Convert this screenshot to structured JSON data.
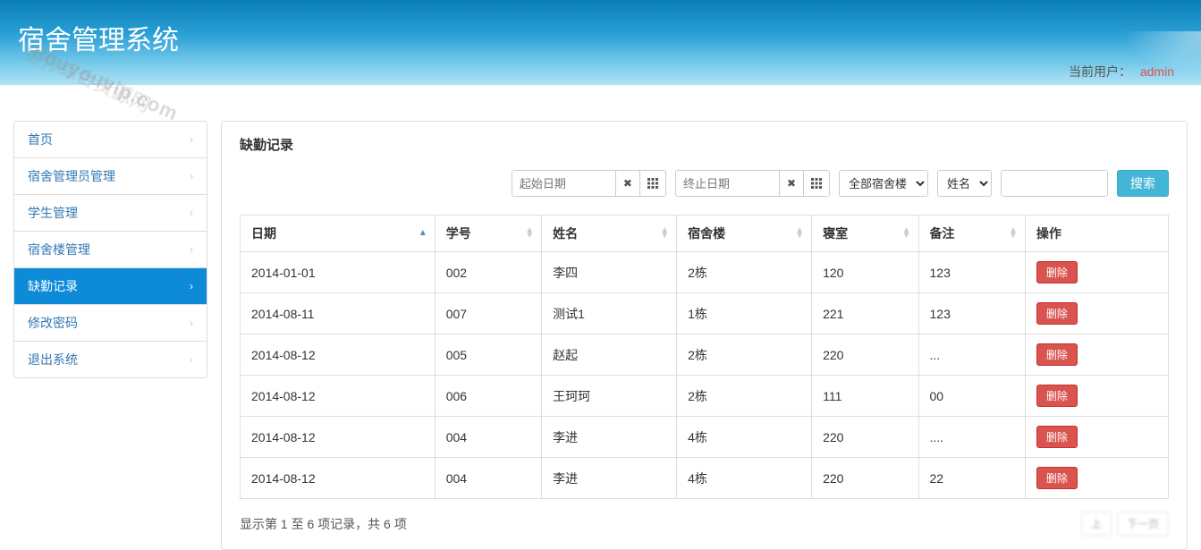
{
  "header": {
    "title": "宿舍管理系统",
    "user_label": "当前用户：",
    "username": "admin"
  },
  "watermark": "douyouvip.com",
  "watermark2": "全有综合资源网",
  "sidebar": {
    "items": [
      {
        "label": "首页",
        "active": false
      },
      {
        "label": "宿舍管理员管理",
        "active": false
      },
      {
        "label": "学生管理",
        "active": false
      },
      {
        "label": "宿舍楼管理",
        "active": false
      },
      {
        "label": "缺勤记录",
        "active": true
      },
      {
        "label": "修改密码",
        "active": false
      },
      {
        "label": "退出系统",
        "active": false
      }
    ]
  },
  "panel": {
    "title": "缺勤记录"
  },
  "filters": {
    "start_placeholder": "起始日期",
    "end_placeholder": "终止日期",
    "building_select": "全部宿舍楼",
    "field_select": "姓名",
    "search_label": "搜索"
  },
  "table": {
    "headers": [
      "日期",
      "学号",
      "姓名",
      "宿舍楼",
      "寝室",
      "备注",
      "操作"
    ],
    "delete_label": "删除",
    "rows": [
      {
        "date": "2014-01-01",
        "sid": "002",
        "name": "李四",
        "building": "2栋",
        "room": "120",
        "note": "123"
      },
      {
        "date": "2014-08-11",
        "sid": "007",
        "name": "测试1",
        "building": "1栋",
        "room": "221",
        "note": "123"
      },
      {
        "date": "2014-08-12",
        "sid": "005",
        "name": "赵起",
        "building": "2栋",
        "room": "220",
        "note": "..."
      },
      {
        "date": "2014-08-12",
        "sid": "006",
        "name": "王珂珂",
        "building": "2栋",
        "room": "111",
        "note": "00"
      },
      {
        "date": "2014-08-12",
        "sid": "004",
        "name": "李进",
        "building": "4栋",
        "room": "220",
        "note": "...."
      },
      {
        "date": "2014-08-12",
        "sid": "004",
        "name": "李进",
        "building": "4栋",
        "room": "220",
        "note": "22"
      }
    ],
    "info": "显示第 1 至 6 项记录，共 6 项"
  }
}
